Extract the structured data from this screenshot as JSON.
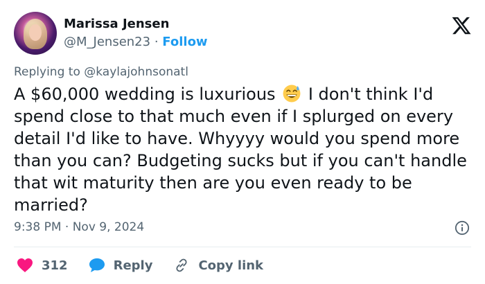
{
  "tweet": {
    "author_name": "Marissa Jensen",
    "handle": "@M_Jensen23",
    "separator": "·",
    "follow_label": "Follow",
    "replying_prefix": "Replying to",
    "replying_to": "@kaylajohnsonatl",
    "text_part1": "A $60,000 wedding is luxurious",
    "emoji": "grinning-face-with-sweat",
    "text_part2": " I don't think I'd spend close to that much even if I splurged on every detail I'd like to have. Whyyyy would you spend more than you can? Budgeting sucks but if you can't handle that wit maturity then are you even ready to be married?",
    "timestamp": "9:38 PM · Nov 9, 2024"
  },
  "actions": {
    "like_count": "312",
    "reply_label": "Reply",
    "copy_link_label": "Copy link"
  },
  "colors": {
    "accent": "#1d9bf0",
    "like": "#f91880",
    "muted": "#536471",
    "text": "#0f1419"
  }
}
